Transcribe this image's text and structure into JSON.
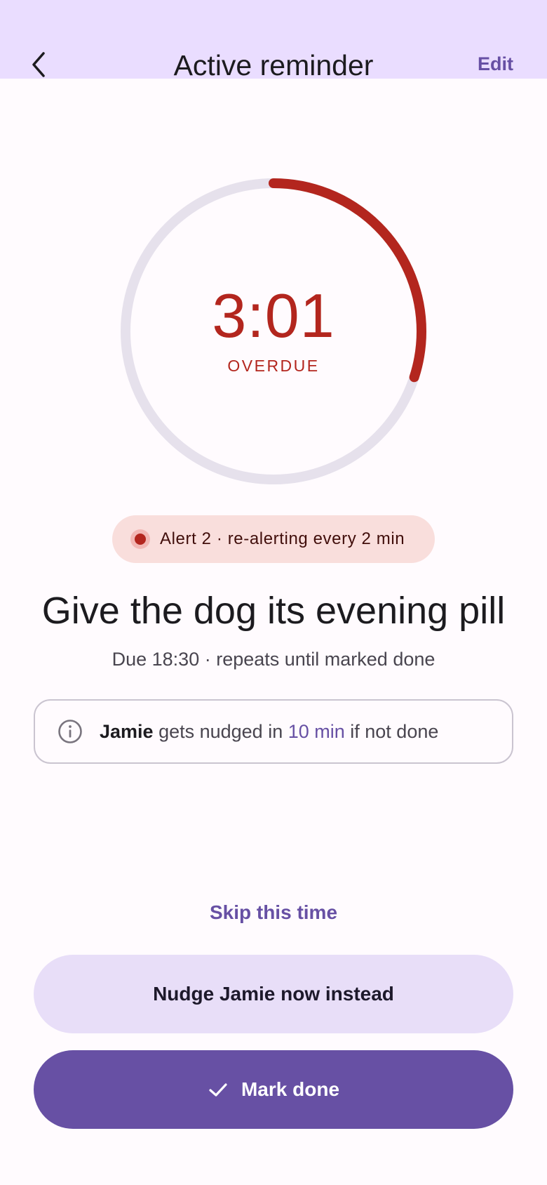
{
  "appbar": {
    "title": "Active reminder",
    "back_icon": "chevron-left-icon",
    "edit_label": "Edit"
  },
  "timer": {
    "time": "3:01",
    "status": "OVERDUE",
    "progress_fraction": 0.3,
    "ring_color": "#b3261e",
    "track_color": "#e6e1ec"
  },
  "alert": {
    "text": "Alert 2 · re-alerting every 2 min"
  },
  "reminder": {
    "title": "Give the dog its evening pill",
    "due": "Due 18:30 · repeats until marked done"
  },
  "info": {
    "icon": "info-icon",
    "name": "Jamie",
    "middle": " gets nudged in ",
    "delay": "10 min",
    "end": " if not done"
  },
  "actions": {
    "skip_label": "Skip this time",
    "nudge_label": "Nudge Jamie now instead",
    "done_label": "Mark done",
    "done_icon": "check-icon"
  },
  "colors": {
    "primary": "#6750a4",
    "error": "#b3261e",
    "appbar": "#eaddff"
  }
}
